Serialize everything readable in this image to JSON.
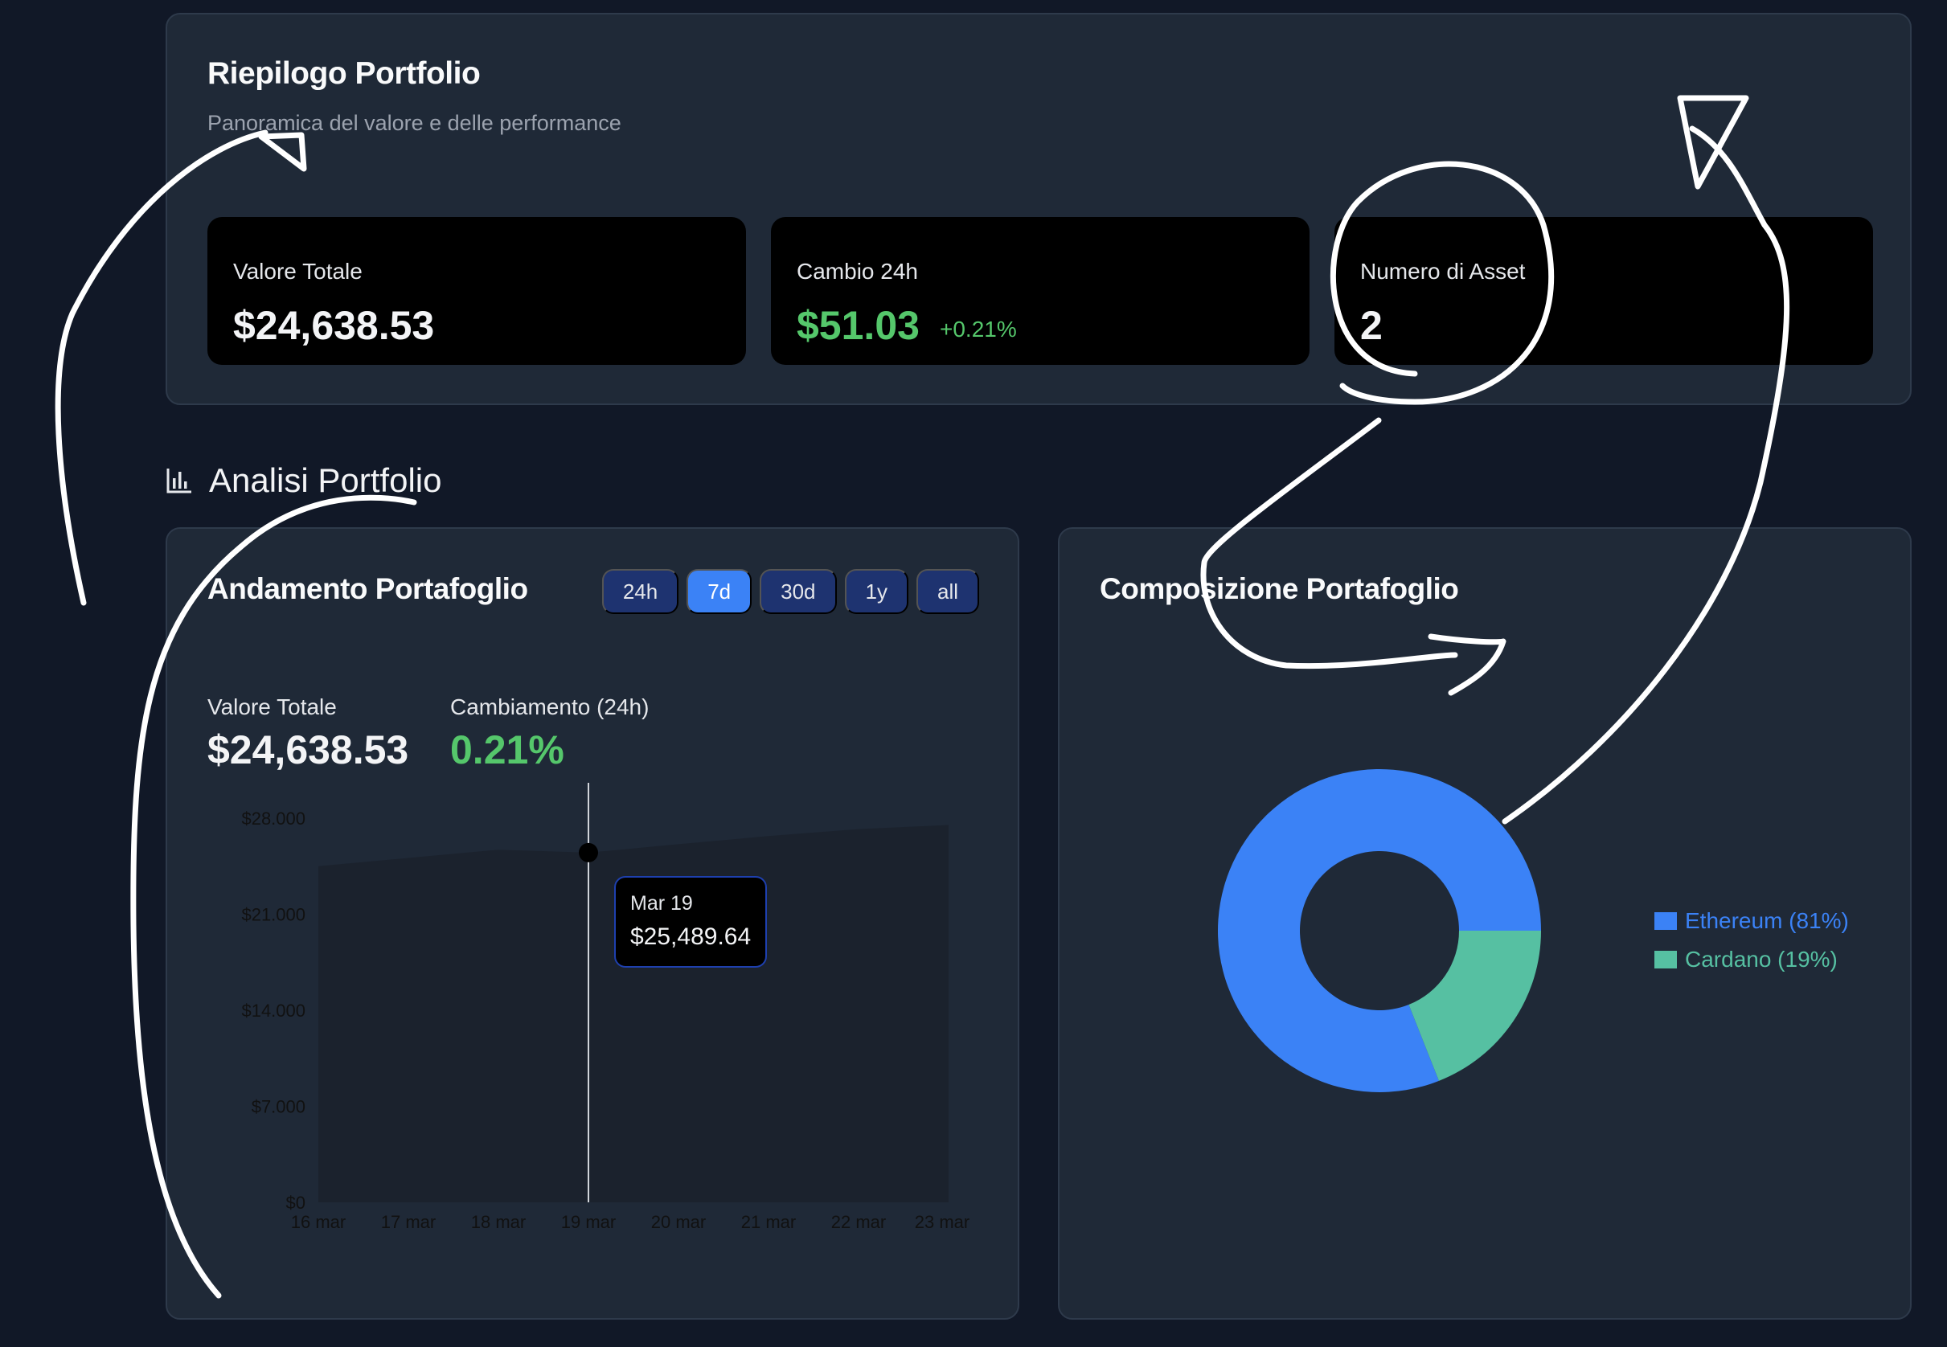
{
  "summary": {
    "title": "Riepilogo Portfolio",
    "subtitle": "Panoramica del valore e delle performance",
    "stats": [
      {
        "label": "Valore Totale",
        "value": "$24,638.53"
      },
      {
        "label": "Cambio 24h",
        "value": "$51.03",
        "delta": "+0.21%"
      },
      {
        "label": "Numero di Asset",
        "value": "2"
      }
    ]
  },
  "analysis": {
    "section_title": "Analisi Portfolio",
    "performance": {
      "title": "Andamento Portafoglio",
      "ranges": [
        "24h",
        "7d",
        "30d",
        "1y",
        "all"
      ],
      "active_range": "7d",
      "total_label": "Valore Totale",
      "total_value": "$24,638.53",
      "change_label": "Cambiamento (24h)",
      "change_value": "0.21%",
      "tooltip": {
        "date": "Mar 19",
        "value": "$25,489.64"
      }
    },
    "composition": {
      "title": "Composizione Portafoglio"
    }
  },
  "colors": {
    "accent": "#3b82f6",
    "positive": "#55c76b",
    "ethereum": "#3b82f6",
    "cardano": "#56c0a2",
    "panel": "#1f2937",
    "background": "#111827"
  },
  "chart_data": [
    {
      "type": "area",
      "x": [
        "16 mar",
        "17 mar",
        "18 mar",
        "19 mar",
        "20 mar",
        "21 mar",
        "22 mar",
        "23 mar"
      ],
      "y_tick_labels": [
        "$0",
        "$7.000",
        "$14.000",
        "$21.000",
        "$28.000"
      ],
      "y_ticks": [
        0,
        7000,
        14000,
        21000,
        28000
      ],
      "ylim": [
        0,
        28000
      ],
      "series": [
        {
          "values": [
            24500,
            25100,
            25700,
            25489.64,
            26100,
            26700,
            27200,
            27500
          ]
        }
      ],
      "highlight": {
        "x": "19 mar",
        "value": 25489.64
      },
      "grid": false
    },
    {
      "type": "pie",
      "labels": [
        "Ethereum (81%)",
        "Cardano (19%)"
      ],
      "values": [
        81,
        19
      ],
      "colors": [
        "#3b82f6",
        "#56c0a2"
      ],
      "legend": "right"
    }
  ]
}
